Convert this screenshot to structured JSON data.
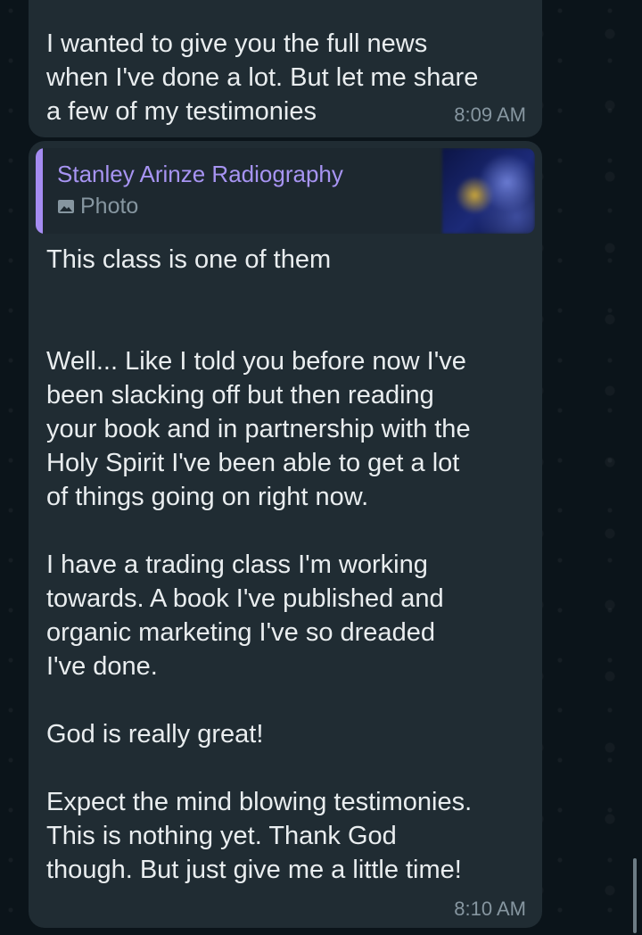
{
  "messages": [
    {
      "text": "I wanted to give you the full news\nwhen I've done a lot. But let me share\na few of my testimonies",
      "time": "8:09 AM"
    },
    {
      "quoted": {
        "author": "Stanley Arinze Radiography",
        "type_label": "Photo",
        "type_icon": "photo-icon"
      },
      "text": "This class is one of them\n\n\nWell... Like I told you before now I've\nbeen slacking off but then reading\nyour book and in partnership with the\nHoly Spirit I've been able to get a lot\nof things going on right now.\n\nI have a trading class I'm working\ntowards. A book I've published and\norganic marketing I've so dreaded\nI've done.\n\nGod is really great!\n\nExpect the mind blowing testimonies.\nThis is nothing yet. Thank God\nthough. But just give me a little time!",
      "time": "8:10 AM"
    }
  ],
  "colors": {
    "background": "#0b141a",
    "bubble": "#202c33",
    "text": "#e9edef",
    "meta": "#8696a0",
    "quote_accent": "#a58cf2"
  }
}
